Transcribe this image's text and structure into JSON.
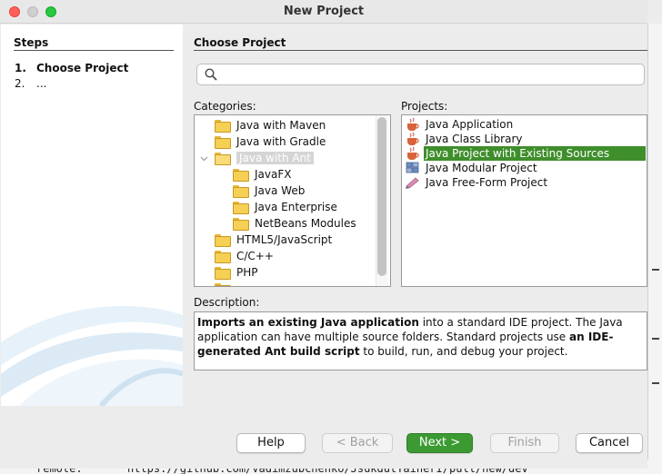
{
  "window": {
    "title": "New Project"
  },
  "steps": {
    "heading": "Steps",
    "items": [
      {
        "num": "1.",
        "label": "Choose Project"
      },
      {
        "num": "2.",
        "label": "..."
      }
    ]
  },
  "main": {
    "heading": "Choose Project",
    "search": {
      "placeholder": "",
      "value": ""
    },
    "categories_label": "Categories:",
    "categories": [
      "Java with Maven",
      "Java with Gradle",
      "Java with Ant",
      "JavaFX",
      "Java Web",
      "Java Enterprise",
      "NetBeans Modules",
      "HTML5/JavaScript",
      "C/C++",
      "PHP"
    ],
    "selected_category": "Java with Ant",
    "projects_label": "Projects:",
    "projects": [
      "Java Application",
      "Java Class Library",
      "Java Project with Existing Sources",
      "Java Modular Project",
      "Java Free-Form Project"
    ],
    "selected_project": "Java Project with Existing Sources",
    "description_label": "Description:",
    "description": {
      "b1": "Imports an existing Java application",
      "t1": " into a standard IDE project. The Java application can have multiple source folders. Standard projects use ",
      "b2": "an IDE-generated Ant build script",
      "t2": " to build, run, and debug your project."
    }
  },
  "buttons": {
    "help": "Help",
    "back": "< Back",
    "next": "Next >",
    "finish": "Finish",
    "cancel": "Cancel"
  },
  "background": {
    "terminal_line_left": "remote:",
    "terminal_line_right": "https://github.com/vadimzubchenko/JsukdutTainerI/pull/new/dev"
  },
  "colors": {
    "selection_green": "#3f8e2c",
    "next_button": "#3c9a33",
    "folder": "#f6cf55"
  }
}
